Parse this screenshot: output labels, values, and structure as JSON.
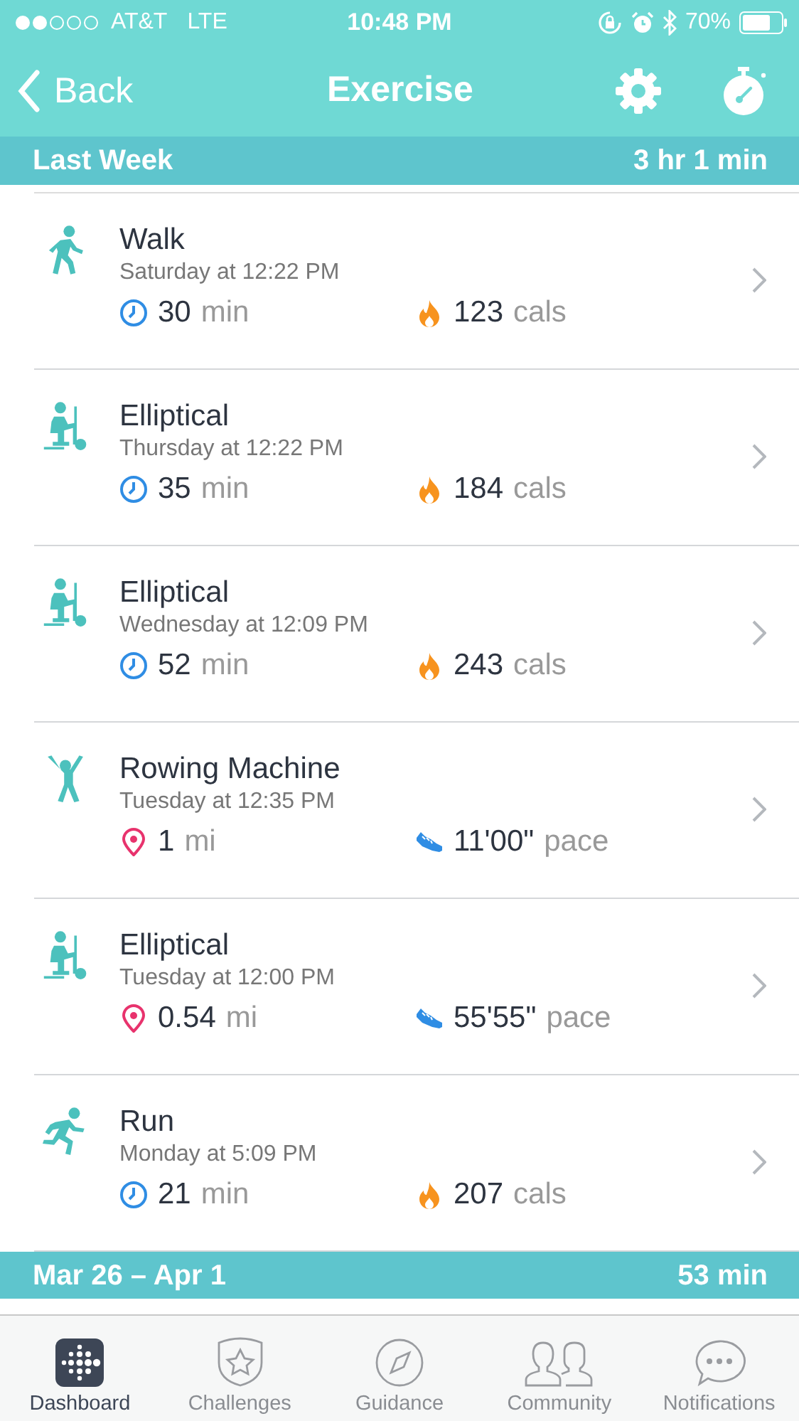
{
  "status_bar": {
    "carrier": "AT&T",
    "network": "LTE",
    "time": "10:48 PM",
    "battery": "70%"
  },
  "nav": {
    "back": "Back",
    "title": "Exercise"
  },
  "sections": [
    {
      "label": "Last Week",
      "total": "3 hr 1 min",
      "entries": [
        {
          "kind": "walk",
          "name": "Walk",
          "when": "Saturday at 12:22 PM",
          "stats": [
            {
              "kind": "duration",
              "value": "30",
              "unit": "min"
            },
            {
              "kind": "calories",
              "value": "123",
              "unit": "cals"
            }
          ]
        },
        {
          "kind": "elliptical",
          "name": "Elliptical",
          "when": "Thursday at 12:22 PM",
          "stats": [
            {
              "kind": "duration",
              "value": "35",
              "unit": "min"
            },
            {
              "kind": "calories",
              "value": "184",
              "unit": "cals"
            }
          ]
        },
        {
          "kind": "elliptical",
          "name": "Elliptical",
          "when": "Wednesday at 12:09 PM",
          "stats": [
            {
              "kind": "duration",
              "value": "52",
              "unit": "min"
            },
            {
              "kind": "calories",
              "value": "243",
              "unit": "cals"
            }
          ]
        },
        {
          "kind": "rowing",
          "name": "Rowing Machine",
          "when": "Tuesday at 12:35 PM",
          "stats": [
            {
              "kind": "distance",
              "value": "1",
              "unit": "mi"
            },
            {
              "kind": "pace",
              "value": "11'00\"",
              "unit": "pace"
            }
          ]
        },
        {
          "kind": "elliptical",
          "name": "Elliptical",
          "when": "Tuesday at 12:00 PM",
          "stats": [
            {
              "kind": "distance",
              "value": "0.54",
              "unit": "mi"
            },
            {
              "kind": "pace",
              "value": "55'55\"",
              "unit": "pace"
            }
          ]
        },
        {
          "kind": "run",
          "name": "Run",
          "when": "Monday at 5:09 PM",
          "stats": [
            {
              "kind": "duration",
              "value": "21",
              "unit": "min"
            },
            {
              "kind": "calories",
              "value": "207",
              "unit": "cals"
            }
          ]
        }
      ]
    },
    {
      "label": "Mar 26 – Apr 1",
      "total": "53 min"
    }
  ],
  "tabs": [
    {
      "kind": "dashboard",
      "label": "Dashboard",
      "selected": true
    },
    {
      "kind": "challenges",
      "label": "Challenges",
      "selected": false
    },
    {
      "kind": "guidance",
      "label": "Guidance",
      "selected": false
    },
    {
      "kind": "community",
      "label": "Community",
      "selected": false
    },
    {
      "kind": "notifications",
      "label": "Notifications",
      "selected": false
    }
  ]
}
